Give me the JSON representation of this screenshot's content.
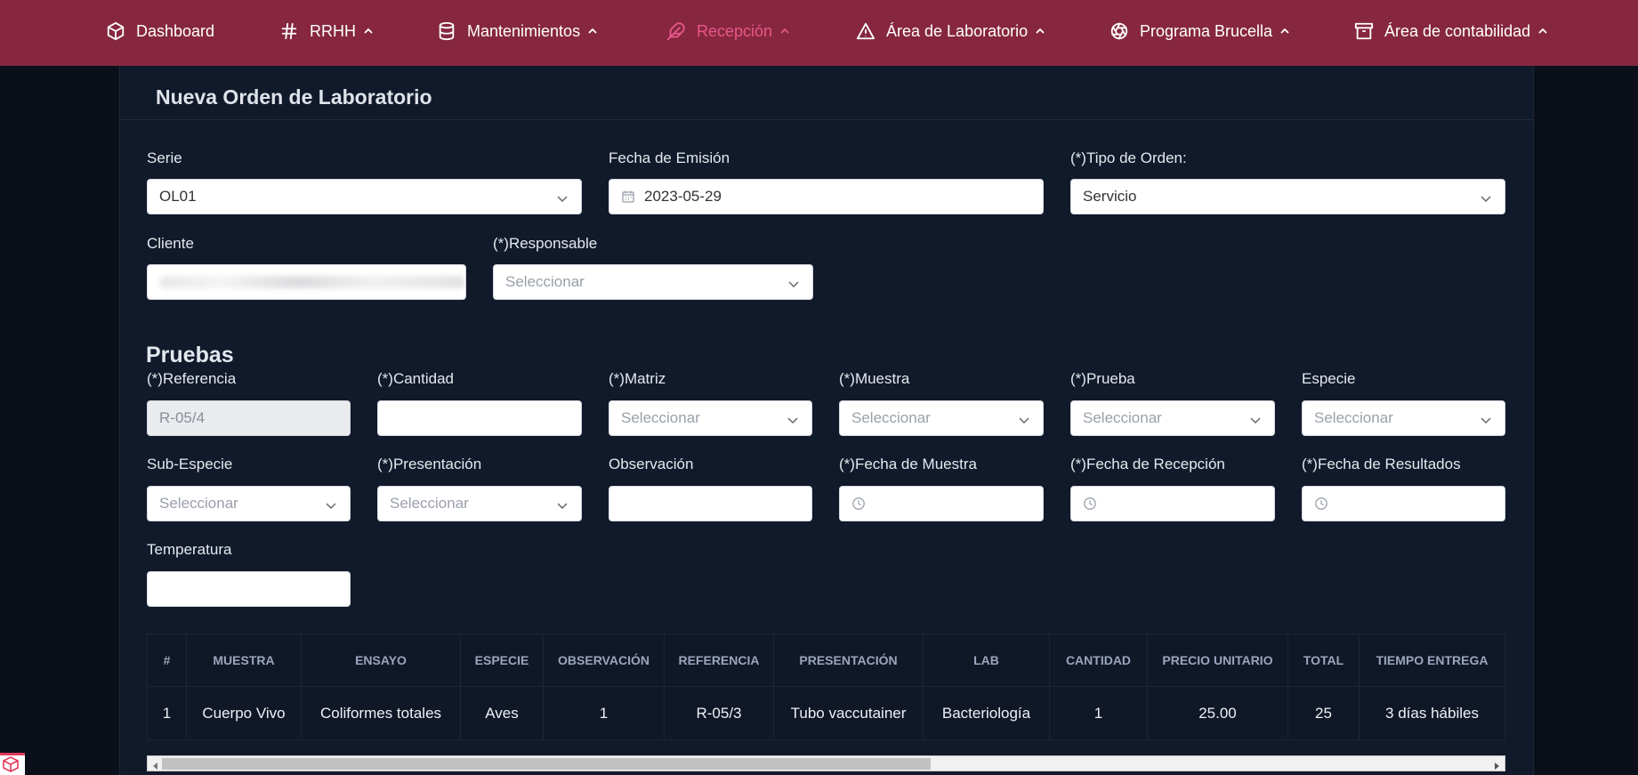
{
  "nav": {
    "items": [
      {
        "label": "Dashboard",
        "icon": "cube-icon",
        "dropdown": false
      },
      {
        "label": "RRHH",
        "icon": "hash-icon",
        "dropdown": true
      },
      {
        "label": "Mantenimientos",
        "icon": "database-icon",
        "dropdown": true
      },
      {
        "label": "Recepción",
        "icon": "feather-icon",
        "dropdown": true,
        "active": true
      },
      {
        "label": "Área de Laboratorio",
        "icon": "alert-triangle-icon",
        "dropdown": true
      },
      {
        "label": "Programa Brucella",
        "icon": "aperture-icon",
        "dropdown": true
      },
      {
        "label": "Área de contabilidad",
        "icon": "archive-icon",
        "dropdown": true
      }
    ],
    "colors": {
      "background": "#86273f",
      "active": "#e8578a"
    }
  },
  "page": {
    "title": "Nueva Orden de Laboratorio"
  },
  "form": {
    "serie": {
      "label": "Serie",
      "value": "OL01"
    },
    "fecha_emision": {
      "label": "Fecha de Emisión",
      "value": "2023-05-29"
    },
    "tipo_orden": {
      "label": "(*)Tipo de Orden:",
      "value": "Servicio"
    },
    "cliente": {
      "label": "Cliente",
      "value": ""
    },
    "responsable": {
      "label": "(*)Responsable",
      "placeholder": "Seleccionar"
    }
  },
  "pruebas": {
    "title": "Pruebas",
    "referencia": {
      "label": "(*)Referencia",
      "value": "R-05/4"
    },
    "cantidad": {
      "label": "(*)Cantidad",
      "value": ""
    },
    "matriz": {
      "label": "(*)Matriz",
      "placeholder": "Seleccionar"
    },
    "muestra": {
      "label": "(*)Muestra",
      "placeholder": "Seleccionar"
    },
    "prueba": {
      "label": "(*)Prueba",
      "placeholder": "Seleccionar"
    },
    "especie": {
      "label": "Especie",
      "placeholder": "Seleccionar"
    },
    "sub_especie": {
      "label": "Sub-Especie",
      "placeholder": "Seleccionar"
    },
    "presentacion": {
      "label": "(*)Presentación",
      "placeholder": "Seleccionar"
    },
    "observacion": {
      "label": "Observación",
      "value": ""
    },
    "fecha_muestra": {
      "label": "(*)Fecha de Muestra",
      "value": ""
    },
    "fecha_recepcion": {
      "label": "(*)Fecha de Recepción",
      "value": ""
    },
    "fecha_resultados": {
      "label": "(*)Fecha de Resultados",
      "value": ""
    },
    "temperatura": {
      "label": "Temperatura",
      "value": ""
    }
  },
  "table": {
    "columns": [
      "#",
      "MUESTRA",
      "ENSAYO",
      "ESPECIE",
      "OBSERVACIÓN",
      "REFERENCIA",
      "PRESENTACIÓN",
      "LAB",
      "CANTIDAD",
      "PRECIO UNITARIO",
      "TOTAL",
      "TIEMPO ENTREGA"
    ],
    "rows": [
      [
        "1",
        "Cuerpo Vivo",
        "Coliformes totales",
        "Aves",
        "1",
        "R-05/3",
        "Tubo vaccutainer",
        "Bacteriología",
        "1",
        "25.00",
        "25",
        "3 días hábiles"
      ]
    ]
  }
}
